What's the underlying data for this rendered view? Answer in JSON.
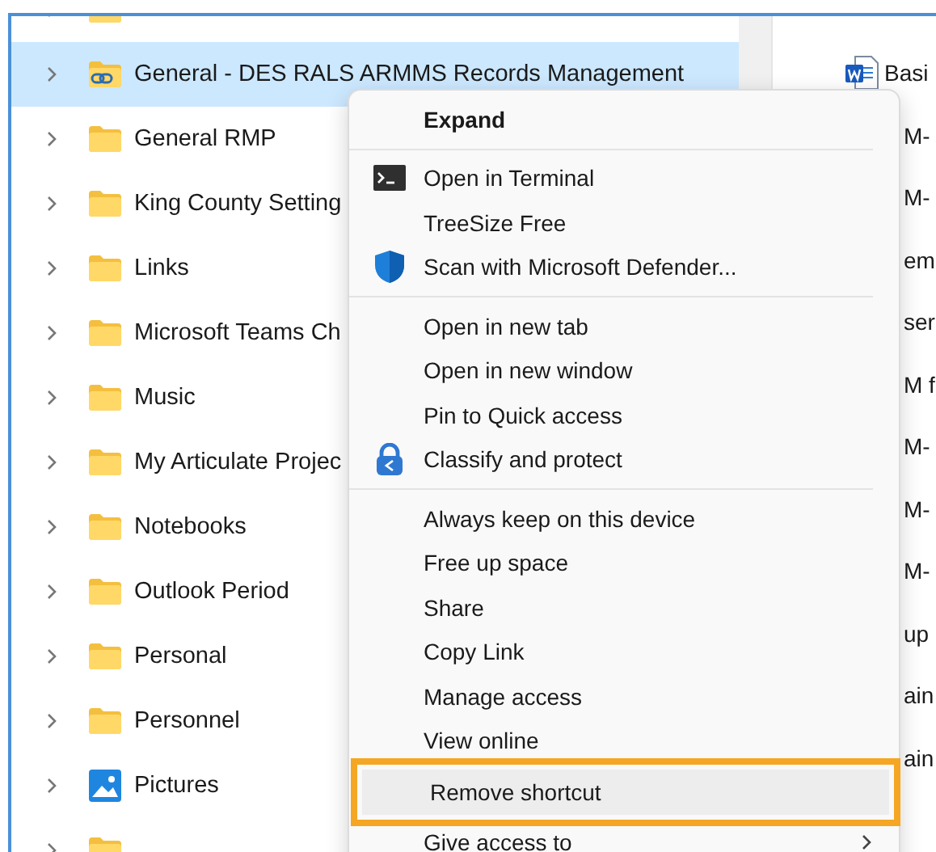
{
  "tree": {
    "items": [
      {
        "kind": "folder",
        "selected": false
      },
      {
        "label": "General - DES RALS ARMMS Records Management",
        "kind": "shared-folder",
        "selected": true
      },
      {
        "label": "General RMP",
        "kind": "folder",
        "selected": false
      },
      {
        "label": "King County Setting",
        "kind": "folder",
        "selected": false
      },
      {
        "label": "Links",
        "kind": "folder",
        "selected": false
      },
      {
        "label": "Microsoft Teams Ch",
        "kind": "folder",
        "selected": false
      },
      {
        "label": "Music",
        "kind": "folder",
        "selected": false
      },
      {
        "label": "My Articulate Projec",
        "kind": "folder",
        "selected": false
      },
      {
        "label": "Notebooks",
        "kind": "folder",
        "selected": false
      },
      {
        "label": "Outlook Period",
        "kind": "folder",
        "selected": false
      },
      {
        "label": "Personal",
        "kind": "folder",
        "selected": false
      },
      {
        "label": "Personnel",
        "kind": "folder",
        "selected": false
      },
      {
        "label": "Pictures",
        "kind": "pictures",
        "selected": false
      },
      {
        "kind": "folder",
        "selected": false
      }
    ]
  },
  "files": [
    {
      "label": "Basi",
      "kind": "word"
    },
    {
      "label": "M-",
      "kind": "plain"
    },
    {
      "label": "M-",
      "kind": "plain"
    },
    {
      "label": "em",
      "kind": "plain"
    },
    {
      "label": "ser",
      "kind": "plain"
    },
    {
      "label": "M f",
      "kind": "plain"
    },
    {
      "label": "M-",
      "kind": "plain"
    },
    {
      "label": "M-",
      "kind": "plain"
    },
    {
      "label": "M-",
      "kind": "plain"
    },
    {
      "label": "up",
      "kind": "plain"
    },
    {
      "label": "ain",
      "kind": "plain"
    },
    {
      "label": "ain",
      "kind": "plain"
    }
  ],
  "context_menu": {
    "items": [
      {
        "kind": "plain",
        "label": "Expand",
        "default": true,
        "selected": false
      },
      {
        "kind": "separator"
      },
      {
        "kind": "terminal",
        "label": "Open in Terminal",
        "selected": false
      },
      {
        "kind": "plain",
        "label": "TreeSize Free",
        "selected": false
      },
      {
        "kind": "shield",
        "label": "Scan with Microsoft Defender...",
        "selected": false
      },
      {
        "kind": "separator"
      },
      {
        "kind": "plain",
        "label": "Open in new tab",
        "selected": false
      },
      {
        "kind": "plain",
        "label": "Open in new window",
        "selected": false
      },
      {
        "kind": "plain",
        "label": "Pin to Quick access",
        "selected": false
      },
      {
        "kind": "lock",
        "label": "Classify and protect",
        "selected": false
      },
      {
        "kind": "separator"
      },
      {
        "kind": "plain",
        "label": "Always keep on this device",
        "selected": false
      },
      {
        "kind": "plain",
        "label": "Free up space",
        "selected": false
      },
      {
        "kind": "plain",
        "label": "Share",
        "selected": false
      },
      {
        "kind": "plain",
        "label": "Copy Link",
        "selected": false
      },
      {
        "kind": "plain",
        "label": "Manage access",
        "selected": false
      },
      {
        "kind": "plain",
        "label": "View online",
        "selected": false
      },
      {
        "kind": "plain",
        "label": "Remove shortcut",
        "selected": true
      },
      {
        "kind": "plain",
        "label": "Give access to",
        "submenu": true,
        "selected": false
      }
    ]
  }
}
